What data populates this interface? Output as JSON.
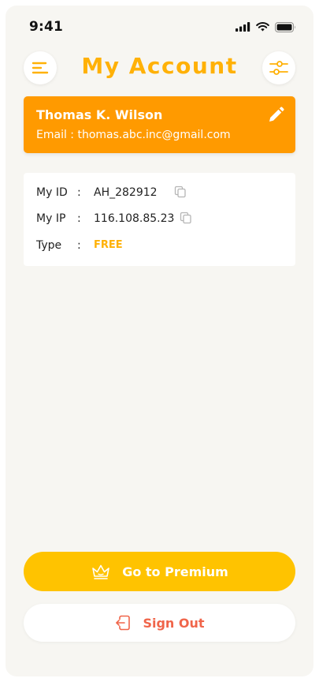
{
  "status_bar": {
    "time": "9:41",
    "icons": [
      "signal-icon",
      "wifi-icon",
      "battery-icon"
    ]
  },
  "header": {
    "title": "My Account",
    "menu_icon": "menu-icon",
    "settings_icon": "sliders-icon"
  },
  "profile": {
    "name": "Thomas K. Wilson",
    "email_label": "Email :",
    "email": "thomas.abc.inc@gmail.com",
    "edit_icon": "pencil-icon"
  },
  "info": {
    "rows": [
      {
        "label": "My ID",
        "colon": ":",
        "value": "AH_282912",
        "copy_icon": "copy-icon"
      },
      {
        "label": "My IP",
        "colon": ":",
        "value": "116.108.85.23",
        "copy_icon": "copy-icon"
      },
      {
        "label": "Type",
        "colon": ":",
        "value": "FREE"
      }
    ]
  },
  "actions": {
    "premium_label": "Go to Premium",
    "premium_icon": "crown-icon",
    "signout_label": "Sign Out",
    "signout_icon": "sign-out-icon"
  },
  "colors": {
    "accent": "#ffb107",
    "profile_card": "#ff9a00",
    "premium_button": "#ffc300",
    "signout_text": "#f0654a",
    "background": "#f7f6f2"
  }
}
